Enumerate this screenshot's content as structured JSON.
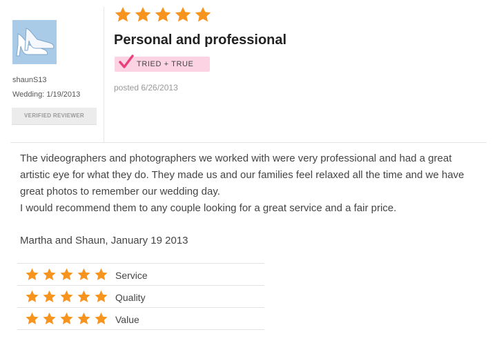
{
  "reviewer": {
    "username": "shaunS13",
    "wedding_date": "Wedding: 1/19/2013",
    "verified_label": "VERIFIED REVIEWER"
  },
  "review": {
    "overall_rating": 5,
    "max_rating": 5,
    "title": "Personal and professional",
    "badge_label": "TRIED + TRUE",
    "posted": "posted 6/26/2013",
    "body": [
      "The videographers and photographers we worked with were very professional and had a great artistic eye for what they do. They made us and our families feel relaxed all the time and we have great photos to remember our wedding day.",
      "I would recommend them to any couple looking for a great service and a fair price."
    ],
    "signature": "Martha and Shaun, January 19 2013"
  },
  "ratings": [
    {
      "label": "Service",
      "value": 5
    },
    {
      "label": "Quality",
      "value": 5
    },
    {
      "label": "Value",
      "value": 5
    }
  ],
  "colors": {
    "star": "#f7941d",
    "badge_bg": "#fbd3e2",
    "check": "#e8407a",
    "avatar_bg": "#a9cbe8"
  },
  "icons": {
    "avatar": "high-heel-shoes-icon",
    "star": "star-icon",
    "badge": "checkmark-icon"
  }
}
